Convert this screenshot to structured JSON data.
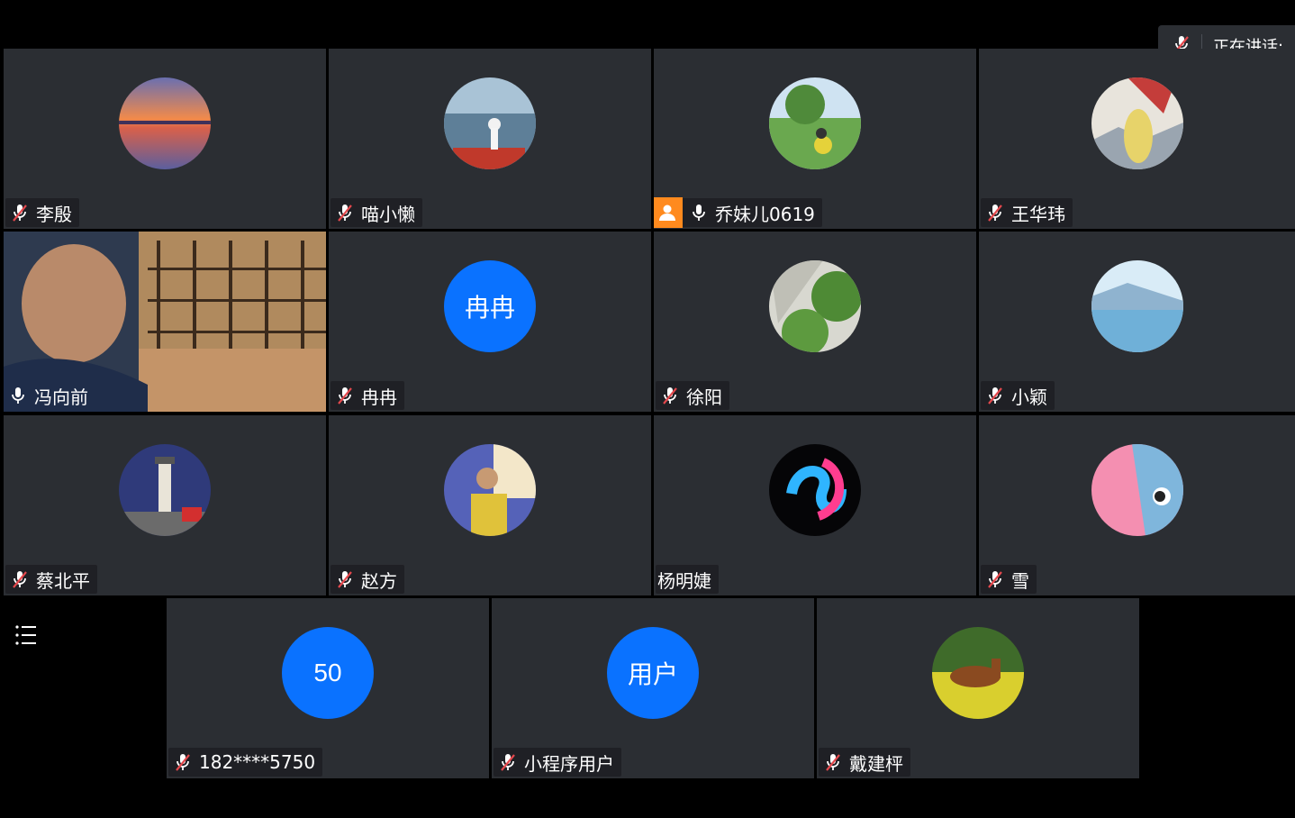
{
  "speaking": {
    "label": "正在讲话:"
  },
  "participants": [
    {
      "name": "李殷",
      "mic": "muted"
    },
    {
      "name": "喵小懒",
      "mic": "muted"
    },
    {
      "name": "乔妹儿0619",
      "mic": "on",
      "host": true
    },
    {
      "name": "王华玮",
      "mic": "muted"
    },
    {
      "name": "冯向前",
      "mic": "on",
      "video": true
    },
    {
      "name": "冉冉",
      "mic": "muted",
      "avatar_text": "冉冉"
    },
    {
      "name": "徐阳",
      "mic": "muted"
    },
    {
      "name": "小颖",
      "mic": "muted"
    },
    {
      "name": "蔡北平",
      "mic": "muted"
    },
    {
      "name": "赵方",
      "mic": "muted"
    },
    {
      "name": "杨明婕",
      "mic": "none"
    },
    {
      "name": "雪",
      "mic": "muted"
    },
    {
      "name": "182****5750",
      "mic": "muted",
      "avatar_text": "50"
    },
    {
      "name": "小程序用户",
      "mic": "muted",
      "avatar_text": "用户"
    },
    {
      "name": "戴建枰",
      "mic": "muted"
    }
  ],
  "colors": {
    "tile_bg": "#2b2e33",
    "avatar_blue": "#0a72ff",
    "host_orange": "#ff8a1e",
    "muted_red": "#e5484d"
  },
  "icons": {
    "muted": "mic-muted-icon",
    "on": "mic-icon",
    "menu": "list-menu-icon",
    "host": "host-person-icon"
  }
}
